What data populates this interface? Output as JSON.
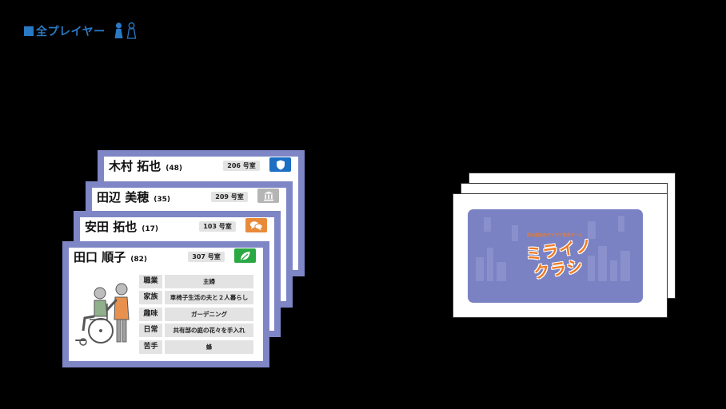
{
  "heading": {
    "title": "全プレイヤー",
    "icon": "two-player-pawns-icon"
  },
  "character_cards": [
    {
      "name": "木村 拓也",
      "age": "(48)",
      "room": "206 号室",
      "badge_color": "#1c6fc2",
      "badge_icon": "shield-icon"
    },
    {
      "name": "田辺 美穂",
      "age": "(35)",
      "room": "209 号室",
      "badge_color": "#b5b5b5",
      "badge_icon": "government-building-icon"
    },
    {
      "name": "安田 拓也",
      "age": "(17)",
      "room": "103 号室",
      "badge_color": "#e98a3a",
      "badge_icon": "chat-bubbles-icon"
    },
    {
      "name": "田口 順子",
      "age": "(82)",
      "room": "307 号室",
      "badge_color": "#2aa843",
      "badge_icon": "leaf-icon",
      "attributes": [
        {
          "label": "職業",
          "value": "主婦"
        },
        {
          "label": "家族",
          "value": "車椅子生活の夫と２人暮らし"
        },
        {
          "label": "趣味",
          "value": "ガーデニング"
        },
        {
          "label": "日常",
          "value": "共有部の庭の花々を手入れ"
        },
        {
          "label": "苦手",
          "value": "蜂"
        }
      ]
    }
  ],
  "game_deck": {
    "subtitle": "防災減災のアイデア発見ゲーム",
    "title_line1": "ミライノ",
    "title_line2": "クラシ",
    "cover_color": "#7a82c3",
    "title_color": "#f07a22"
  }
}
